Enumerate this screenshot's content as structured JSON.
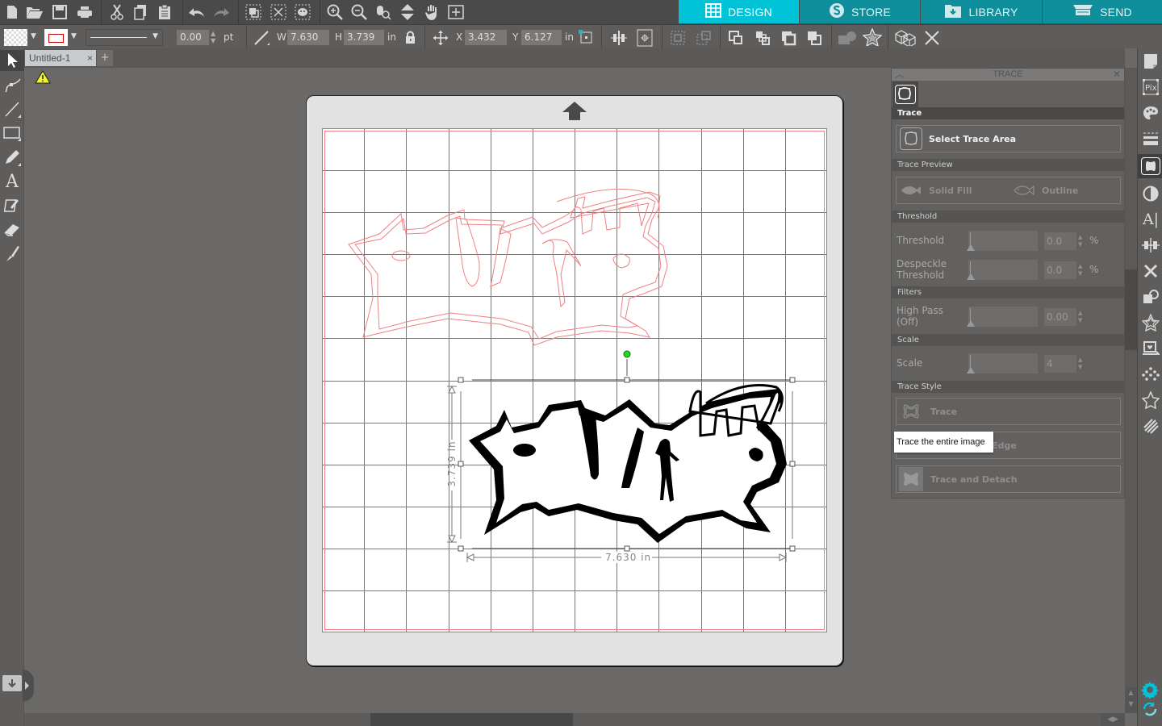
{
  "colors": {
    "accent": "#00c3d8",
    "mode_tab_bg": "#0e8f9b",
    "cut_line": "#f08080",
    "rotate_handle": "#22dd22"
  },
  "toolbar": {
    "file_icons": [
      "new-document-icon",
      "open-folder-icon",
      "save-icon",
      "print-icon"
    ],
    "edit_icons": [
      "cut-icon",
      "copy-icon",
      "paste-icon"
    ],
    "history_icons": [
      "undo-icon",
      "redo-icon"
    ],
    "select_icons": [
      "select-all-icon",
      "deselect-icon",
      "select-by-color-icon"
    ],
    "view_icons": [
      "zoom-in-icon",
      "zoom-out-icon",
      "zoom-select-icon",
      "fit-to-page-icon",
      "pan-icon",
      "zoom-fit-icon"
    ]
  },
  "mode_tabs": [
    {
      "label": "DESIGN",
      "icon": "grid-icon",
      "active": true
    },
    {
      "label": "STORE",
      "icon": "silhouette-s-icon",
      "active": false
    },
    {
      "label": "LIBRARY",
      "icon": "library-folder-icon",
      "active": false
    },
    {
      "label": "SEND",
      "icon": "cutter-icon",
      "active": false
    }
  ],
  "options_bar": {
    "line_width_value": "0.00",
    "line_width_unit": "pt",
    "size": {
      "w_label": "W",
      "w_value": "7.630",
      "h_label": "H",
      "h_value": "3.739",
      "unit": "in"
    },
    "position": {
      "x_label": "X",
      "x_value": "3.432",
      "y_label": "Y",
      "y_value": "6.127",
      "unit": "in"
    }
  },
  "document_tab": {
    "title": "Untitled-1",
    "close": "×",
    "add": "+"
  },
  "left_tools": [
    "select-arrow-icon",
    "point-edit-icon",
    "line-tool-icon",
    "rectangle-tool-icon",
    "pencil-tool-icon",
    "text-tool-icon",
    "sketch-tool-icon",
    "eraser-tool-icon",
    "knife-tool-icon"
  ],
  "canvas": {
    "width_dimension": "7.630 in",
    "height_dimension": "3.739 in",
    "artwork_text": "PUMP itup"
  },
  "trace_panel": {
    "title": "TRACE",
    "section_trace": "Trace",
    "select_trace_area": "Select Trace Area",
    "section_preview": "Trace Preview",
    "solid_fill": "Solid Fill",
    "outline": "Outline",
    "section_threshold": "Threshold",
    "threshold_label": "Threshold",
    "threshold_value": "0.0",
    "threshold_unit": "%",
    "threshold_level": 0,
    "despeckle_label_1": "Despeckle",
    "despeckle_label_2": "Threshold",
    "despeckle_value": "0.0",
    "despeckle_unit": "%",
    "despeckle_level": 0,
    "section_filters": "Filters",
    "highpass_label_1": "High Pass",
    "highpass_label_2": "(Off)",
    "highpass_value": "0.00",
    "highpass_level": 0,
    "section_scale": "Scale",
    "scale_label": "Scale",
    "scale_value": "4",
    "scale_level": 0,
    "section_style": "Trace Style",
    "trace_btn": "Trace",
    "trace_outer_edge_btn": "Trace Outer Edge",
    "trace_detach_btn": "Trace and Detach",
    "tooltip": "Trace the entire image"
  },
  "right_strip": [
    "page-setup-icon",
    "pixscan-icon",
    "fill-color-icon",
    "line-style-icon",
    "trace-icon",
    "image-effects-icon",
    "text-style-icon",
    "align-icon",
    "replicate-icon",
    "modify-icon",
    "offset-icon",
    "send-to-library-icon",
    "rhinestone-icon",
    "star-icon",
    "sketch-fill-icon"
  ]
}
